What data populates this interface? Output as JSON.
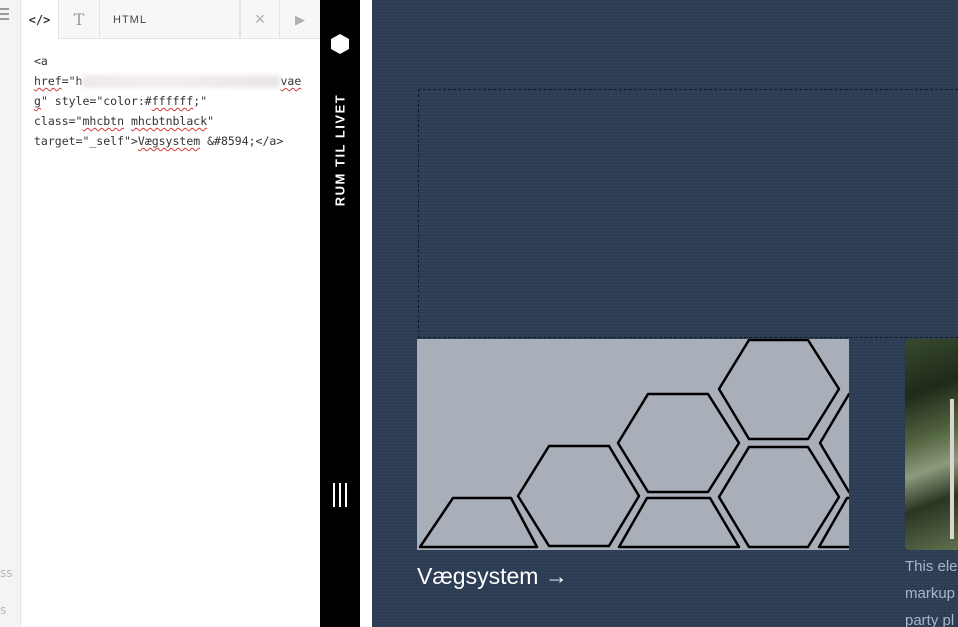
{
  "rail": {
    "fragment_1": "ss",
    "fragment_2": "s"
  },
  "editor": {
    "tabs": {
      "code_icon": "</>",
      "text_icon": "T",
      "html_label": "HTML",
      "close_icon": "×",
      "run_icon": "▶"
    },
    "code": {
      "l1": "<a",
      "l2a": "href",
      "l2b": "=\"h",
      "l2c": "vae",
      "l3a": "g",
      "l3b": "\" style=\"color:#",
      "l3c": "ffffff",
      "l3d": ";\"",
      "l4a": "class=\"",
      "l4b": "mhcbtn",
      "l4c": " ",
      "l4d": "mhcbtnblack",
      "l4e": "\"",
      "l5a": "target=\"_self\">",
      "l5b": "Vægsystem",
      "l5c": " &#8594;</a>"
    }
  },
  "sidebar_bar": {
    "title": "RUM TIL LIVET",
    "logo_icon": "hexagon-icon",
    "menu_icon": "bars-icon"
  },
  "content": {
    "link_label": "Vægsystem →",
    "desc_lines": [
      "This ele",
      "markup",
      "party pl"
    ]
  },
  "colors": {
    "content_bg": "#2c3d55",
    "bar_bg": "#000000",
    "image_bg": "#a9afb9"
  }
}
